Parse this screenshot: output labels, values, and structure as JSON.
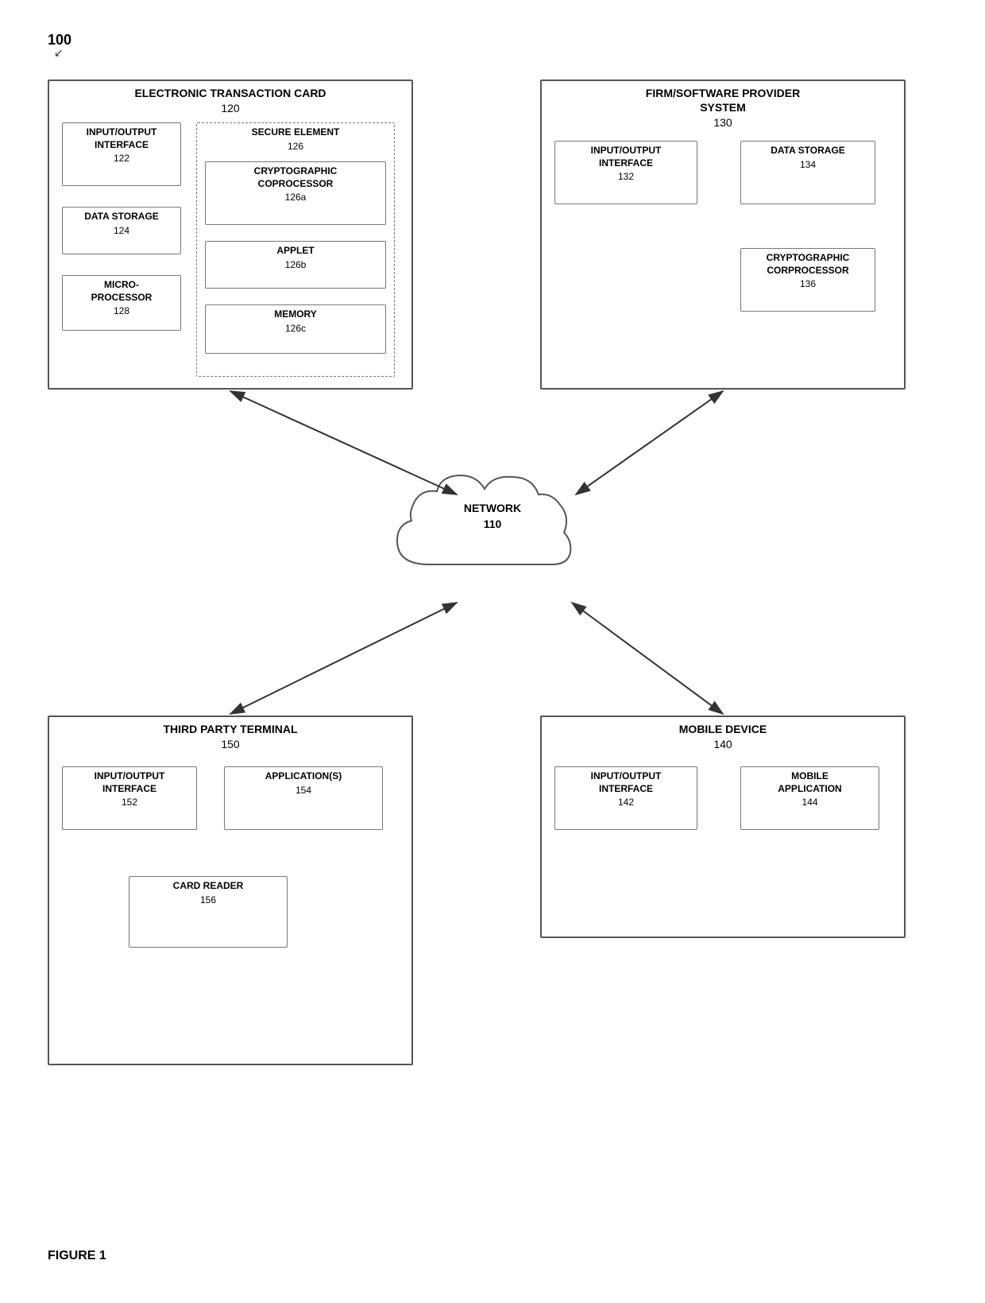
{
  "diagram": {
    "id": "100",
    "figure_label": "FIGURE 1",
    "boxes": {
      "electronic_transaction_card": {
        "title": "ELECTRONIC TRANSACTION CARD",
        "number": "120",
        "components": {
          "io_interface": {
            "label": "INPUT/OUTPUT\nINTERFACE",
            "number": "122"
          },
          "data_storage": {
            "label": "DATA STORAGE",
            "number": "124"
          },
          "microprocessor": {
            "label": "MICRO-\nPROCESSOR",
            "number": "128"
          },
          "secure_element": {
            "title": "SECURE ELEMENT",
            "number": "126",
            "sub": {
              "crypto_coprocessor": {
                "label": "CRYPTOGRAPHIC\nCOPROCESSOR",
                "number": "126a"
              },
              "applet": {
                "label": "APPLET",
                "number": "126b"
              },
              "memory": {
                "label": "MEMORY",
                "number": "126c"
              }
            }
          }
        }
      },
      "firm_software": {
        "title": "FIRM/SOFTWARE PROVIDER\nSYSTEM",
        "number": "130",
        "components": {
          "io_interface": {
            "label": "INPUT/OUTPUT\nINTERFACE",
            "number": "132"
          },
          "data_storage": {
            "label": "DATA STORAGE",
            "number": "134"
          },
          "crypto_coprocessor": {
            "label": "CRYPTOGRAPHIC\nCORPROCESSOR",
            "number": "136"
          }
        }
      },
      "network": {
        "label": "NETWORK",
        "number": "110"
      },
      "third_party_terminal": {
        "title": "THIRD PARTY TERMINAL",
        "number": "150",
        "components": {
          "io_interface": {
            "label": "INPUT/OUTPUT\nINTERFACE",
            "number": "152"
          },
          "applications": {
            "label": "APPLICATION(S)",
            "number": "154"
          },
          "card_reader": {
            "label": "CARD READER",
            "number": "156"
          }
        }
      },
      "mobile_device": {
        "title": "MOBILE DEVICE",
        "number": "140",
        "components": {
          "io_interface": {
            "label": "INPUT/OUTPUT\nINTERFACE",
            "number": "142"
          },
          "mobile_application": {
            "label": "MOBILE\nAPPLICATION",
            "number": "144"
          }
        }
      }
    }
  }
}
